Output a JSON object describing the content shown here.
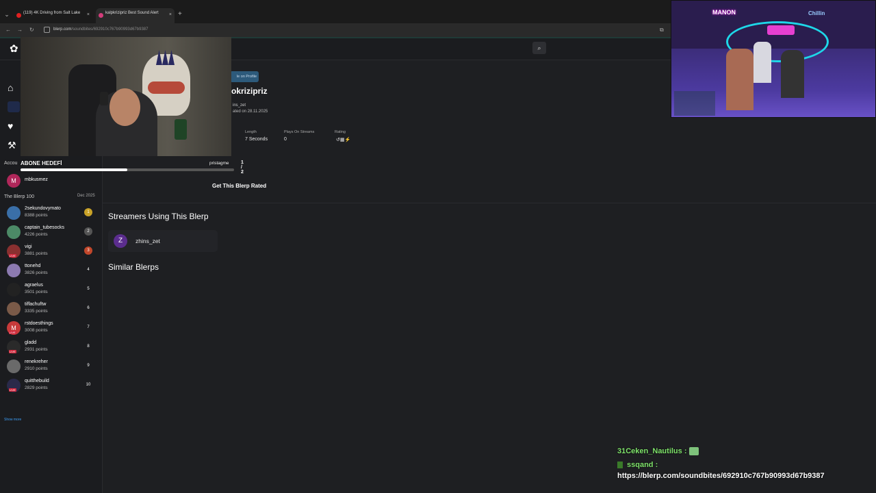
{
  "browser": {
    "tabs": [
      {
        "label": "(119) 4K Driving from Salt Lake",
        "close": "×"
      },
      {
        "label": "kalpkrizipriz Best Sound Alert",
        "close": "×"
      }
    ],
    "new_tab": "+",
    "url_host": "blerp.com",
    "url_path": "/soundbites/692910c767b90993d67b9387"
  },
  "webcam": {
    "goal_label": "ABONE HEDEFİ",
    "goal_name": "pristagme",
    "goal_count": "1 / 2",
    "goal_progress": 0.5
  },
  "sidebar": {
    "account_label": "Accou",
    "account_user": {
      "initial": "M",
      "name": "mbkusmez"
    },
    "leaderboard_title": "The Blerp 100",
    "leaderboard_period": "Dec 2025",
    "leaderboard": [
      {
        "name": "2sekundovymato",
        "points": "8388 points",
        "rank": "1",
        "initial": "",
        "color": "#3a6fa8",
        "rank_color": "#c9a227",
        "live": false
      },
      {
        "name": "captain_tubesocks",
        "points": "4226 points",
        "rank": "2",
        "initial": "",
        "color": "#4c8a66",
        "rank_color": "#555",
        "live": false
      },
      {
        "name": "vigi",
        "points": "3881 points",
        "rank": "3",
        "initial": "",
        "color": "#8a3030",
        "rank_color": "#c2472b",
        "live": true
      },
      {
        "name": "ttonehd",
        "points": "3826 points",
        "rank": "4",
        "initial": "",
        "color": "#8c7ab0",
        "rank_color": "transparent",
        "live": false
      },
      {
        "name": "agraelus",
        "points": "3501 points",
        "rank": "5",
        "initial": "",
        "color": "#222",
        "rank_color": "transparent",
        "live": false
      },
      {
        "name": "tiffachuftw",
        "points": "3335 points",
        "rank": "6",
        "initial": "",
        "color": "#7a5a48",
        "rank_color": "transparent",
        "live": false
      },
      {
        "name": "rstdoesthings",
        "points": "3008 points",
        "rank": "7",
        "initial": "M",
        "color": "#c83a3a",
        "rank_color": "transparent",
        "live": true
      },
      {
        "name": "gladd",
        "points": "2931 points",
        "rank": "8",
        "initial": "",
        "color": "#2a2a2a",
        "rank_color": "transparent",
        "live": true
      },
      {
        "name": "renekreher",
        "points": "2910 points",
        "rank": "9",
        "initial": "",
        "color": "#6a6a6a",
        "rank_color": "transparent",
        "live": false
      },
      {
        "name": "quitthebuild",
        "points": "2829 points",
        "rank": "10",
        "initial": "",
        "color": "#2a2a4a",
        "rank_color": "transparent",
        "live": true
      }
    ],
    "live_badge": "LIVE",
    "show_more": "Show more"
  },
  "detail": {
    "profile_button": "le on Profile",
    "title": "okrizipriz",
    "uploader": "ins_zet",
    "created": "ated on 28.11.2025",
    "meta": [
      {
        "label": "Length",
        "value": "7 Seconds"
      },
      {
        "label": "Plays On Streams",
        "value": "0"
      },
      {
        "label": "Rating",
        "value": "↺▦⚡"
      }
    ],
    "rated_button": "Get This Blerp Rated"
  },
  "streamers": {
    "heading": "Streamers Using This Blerp",
    "items": [
      {
        "initial": "Z",
        "name": "zhins_zet"
      }
    ]
  },
  "similar": {
    "heading": "Similar Blerps"
  },
  "game": {
    "sign_left": "MANON",
    "sign_right": "Chillin"
  },
  "chat": {
    "messages": [
      {
        "user": "31Ceken_Nautilus :",
        "text": ""
      },
      {
        "user": "ssqand :",
        "text": ""
      },
      {
        "user": "",
        "text": "https://blerp.com/soundbites/692910c767b90993d67b9387"
      }
    ]
  }
}
